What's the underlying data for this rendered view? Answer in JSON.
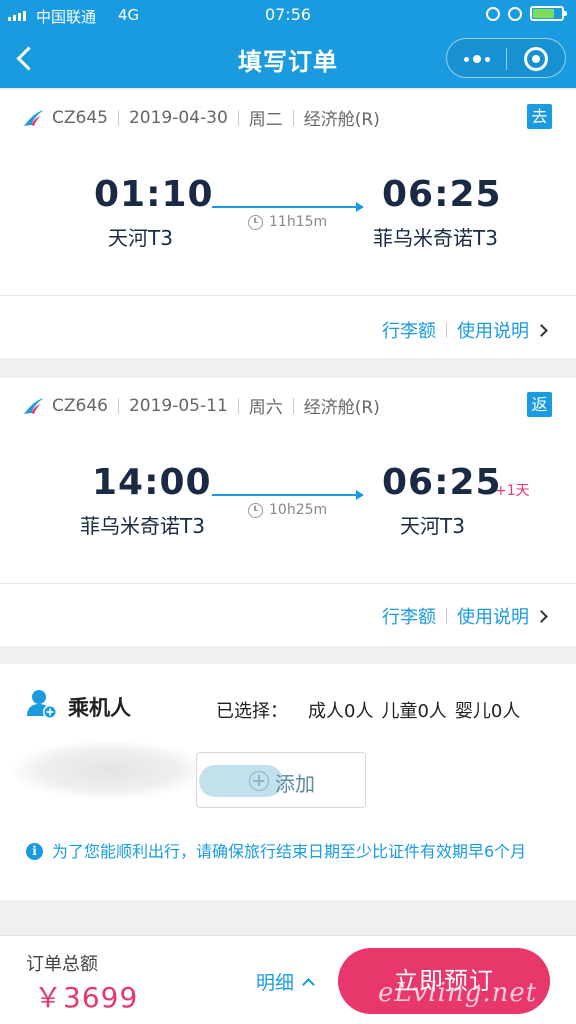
{
  "status_bar": {
    "carrier": "中国联通",
    "network": "4G",
    "time": "07:56"
  },
  "nav": {
    "title": "填写订单"
  },
  "flights": [
    {
      "flight_no": "CZ645",
      "date": "2019-04-30",
      "weekday": "周二",
      "cabin": "经济舱(R)",
      "direction": "去",
      "dep_time": "01:10",
      "dep_station": "天河T3",
      "arr_time": "06:25",
      "arr_station": "菲乌米奇诺T3",
      "duration": "11h15m",
      "baggage_link": "行李额",
      "rules_link": "使用说明"
    },
    {
      "flight_no": "CZ646",
      "date": "2019-05-11",
      "weekday": "周六",
      "cabin": "经济舱(R)",
      "direction": "返",
      "dep_time": "14:00",
      "dep_station": "菲乌米奇诺T3",
      "arr_time": "06:25",
      "arr_station": "天河T3",
      "arr_day_offset": "+1天",
      "duration": "10h25m",
      "baggage_link": "行李额",
      "rules_link": "使用说明"
    }
  ],
  "passengers": {
    "title": "乘机人",
    "selected_label": "已选择：",
    "adult": "成人0人",
    "child": "儿童0人",
    "infant": "婴儿0人",
    "add_label": "添加",
    "notice": "为了您能顺利出行，请确保旅行结束日期至少比证件有效期早6个月"
  },
  "footer": {
    "total_label": "订单总额",
    "total_value": "￥3699",
    "detail_label": "明细",
    "book_label": "立即预订"
  },
  "watermark": "eLvling.net",
  "colors": {
    "brand_blue": "#1a9be0",
    "accent_pink": "#e8376b",
    "text_dark": "#1a2a44",
    "background": "#f0f0f0"
  }
}
